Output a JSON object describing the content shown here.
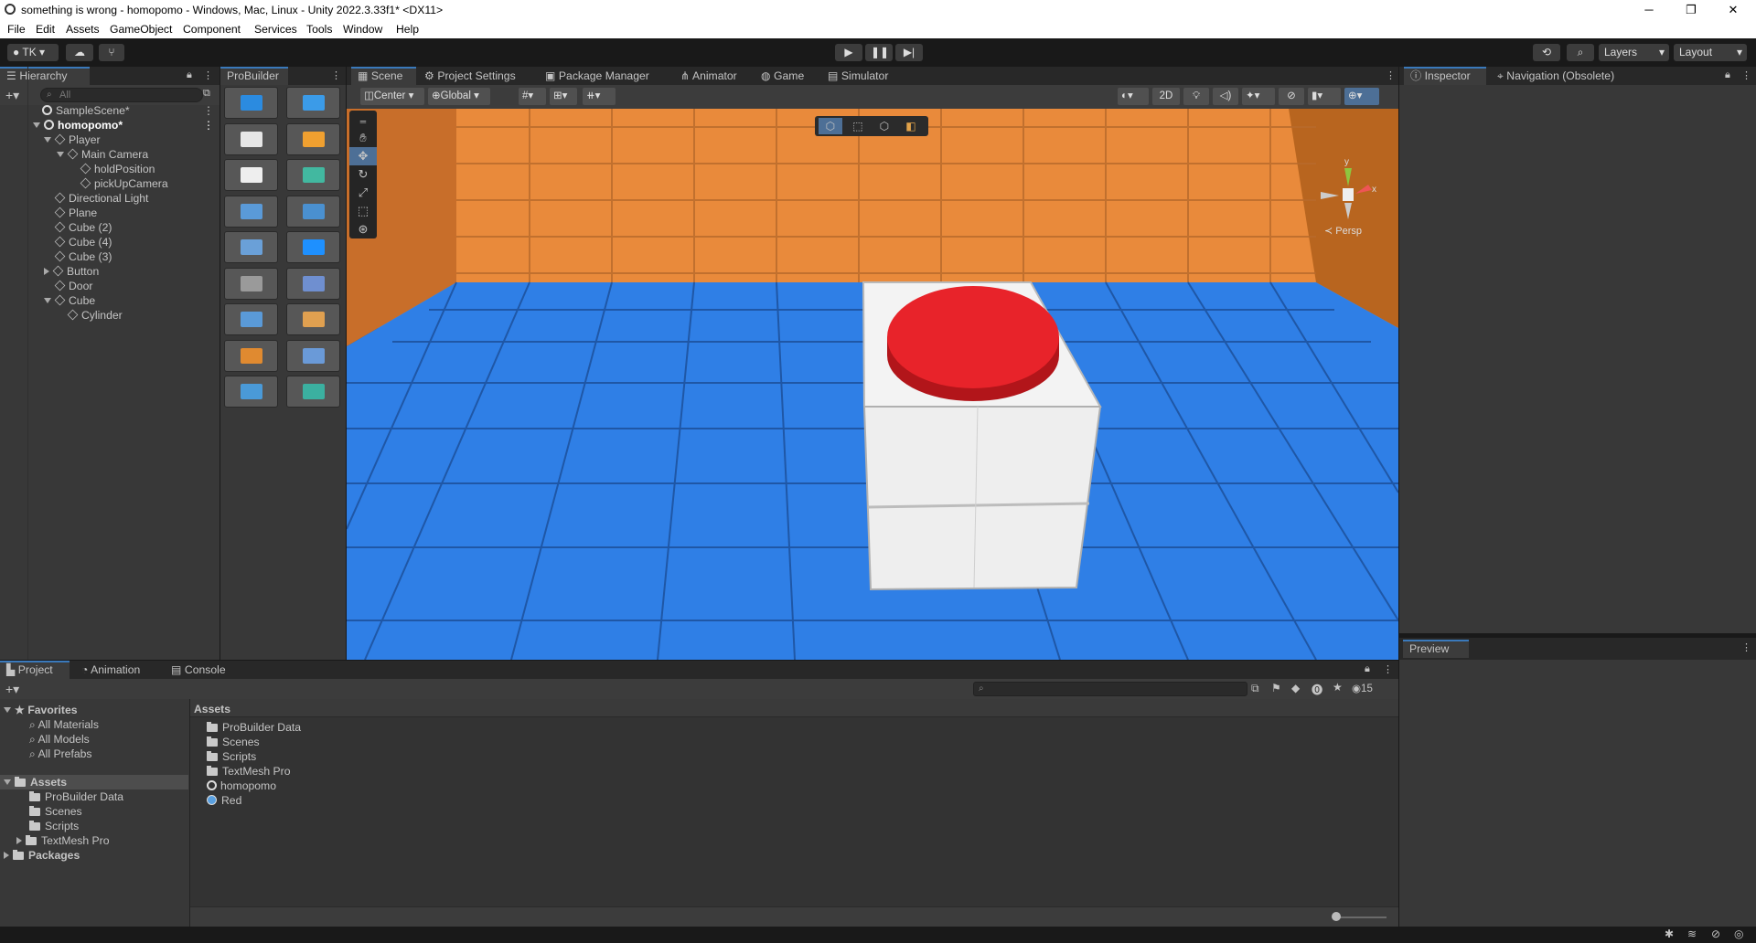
{
  "window": {
    "title": "something is wrong - homopomo - Windows, Mac, Linux - Unity 2022.3.33f1* <DX11>",
    "minimize": "─",
    "maximize": "❐",
    "close": "✕"
  },
  "menu": [
    "File",
    "Edit",
    "Assets",
    "GameObject",
    "Component",
    "Services",
    "Tools",
    "Window",
    "Help"
  ],
  "toolbar": {
    "account": "TK ▾",
    "layers": "Layers",
    "layout": "Layout"
  },
  "hierarchy": {
    "tab": "Hierarchy",
    "search_placeholder": "All",
    "items": [
      {
        "label": "SampleScene*"
      },
      {
        "label": "homopomo*"
      },
      {
        "label": "Player"
      },
      {
        "label": "Main Camera"
      },
      {
        "label": "holdPosition"
      },
      {
        "label": "pickUpCamera"
      },
      {
        "label": "Directional Light"
      },
      {
        "label": "Plane"
      },
      {
        "label": "Cube (2)"
      },
      {
        "label": "Cube (4)"
      },
      {
        "label": "Cube (3)"
      },
      {
        "label": "Button"
      },
      {
        "label": "Door"
      },
      {
        "label": "Cube"
      },
      {
        "label": "Cylinder"
      }
    ]
  },
  "probuilder": {
    "tab": "ProBuilder"
  },
  "scene_tabs": [
    "Scene",
    "Project Settings",
    "Package Manager",
    "Animator",
    "Game",
    "Simulator"
  ],
  "scene_toolbar": {
    "pivot": "Center",
    "space": "Global",
    "mode2d": "2D",
    "persp": "≺ Persp",
    "axis_y": "y",
    "axis_x": "x"
  },
  "inspector": {
    "tabs": [
      "Inspector",
      "Navigation (Obsolete)"
    ],
    "preview": "Preview"
  },
  "bottom_tabs": [
    "Project",
    "Animation",
    "Console"
  ],
  "project": {
    "favorites_label": "Favorites",
    "favorites": [
      "All Materials",
      "All Models",
      "All Prefabs"
    ],
    "assets_label": "Assets",
    "asset_folders": [
      "ProBuilder Data",
      "Scenes",
      "Scripts",
      "TextMesh Pro"
    ],
    "packages_label": "Packages",
    "breadcrumb": "Assets",
    "files": [
      {
        "label": "ProBuilder Data",
        "type": "folder"
      },
      {
        "label": "Scenes",
        "type": "folder"
      },
      {
        "label": "Scripts",
        "type": "folder"
      },
      {
        "label": "TextMesh Pro",
        "type": "folder"
      },
      {
        "label": "homopomo",
        "type": "scene"
      },
      {
        "label": "Red",
        "type": "material"
      }
    ],
    "hidden_count": "15"
  },
  "colors": {
    "accent": "#3a79bb",
    "floor": "#2f7fe6",
    "wall": "#e98a3b",
    "button": "#e8232a"
  }
}
